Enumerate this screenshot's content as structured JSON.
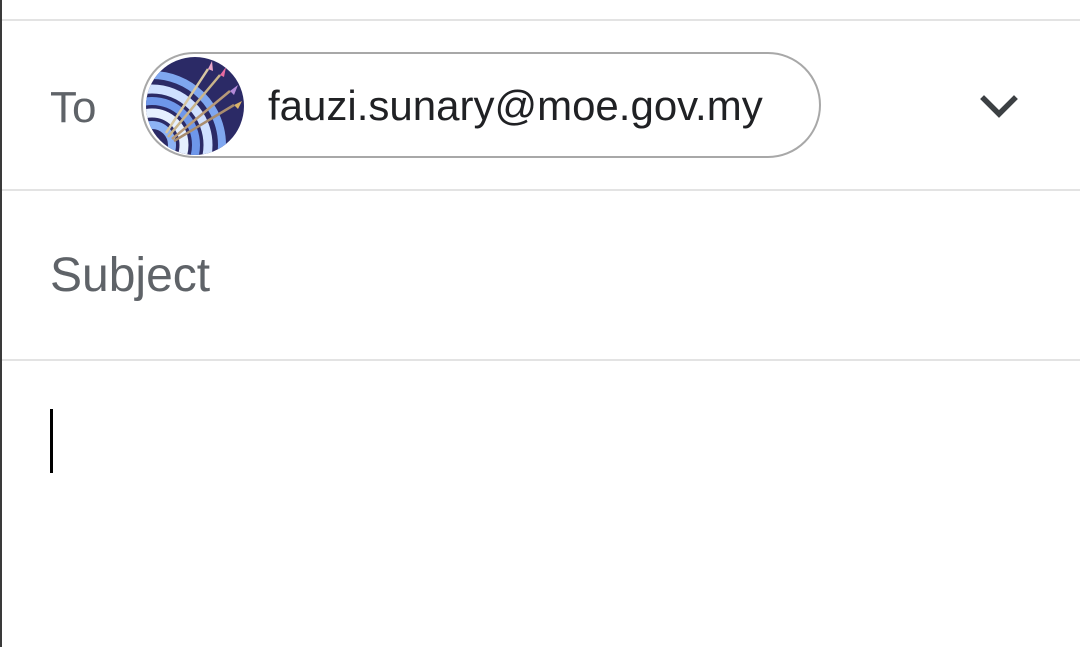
{
  "compose": {
    "to_label": "To",
    "recipient": {
      "email": "fauzi.sunary@moe.gov.my",
      "avatar": "archery-target-avatar"
    },
    "expand_icon": "chevron-down-icon",
    "subject_placeholder": "Subject",
    "body_value": ""
  },
  "colors": {
    "label": "#5f6368",
    "text": "#202124",
    "chip_border": "#a8a8a8",
    "divider": "#e3e3e3"
  }
}
